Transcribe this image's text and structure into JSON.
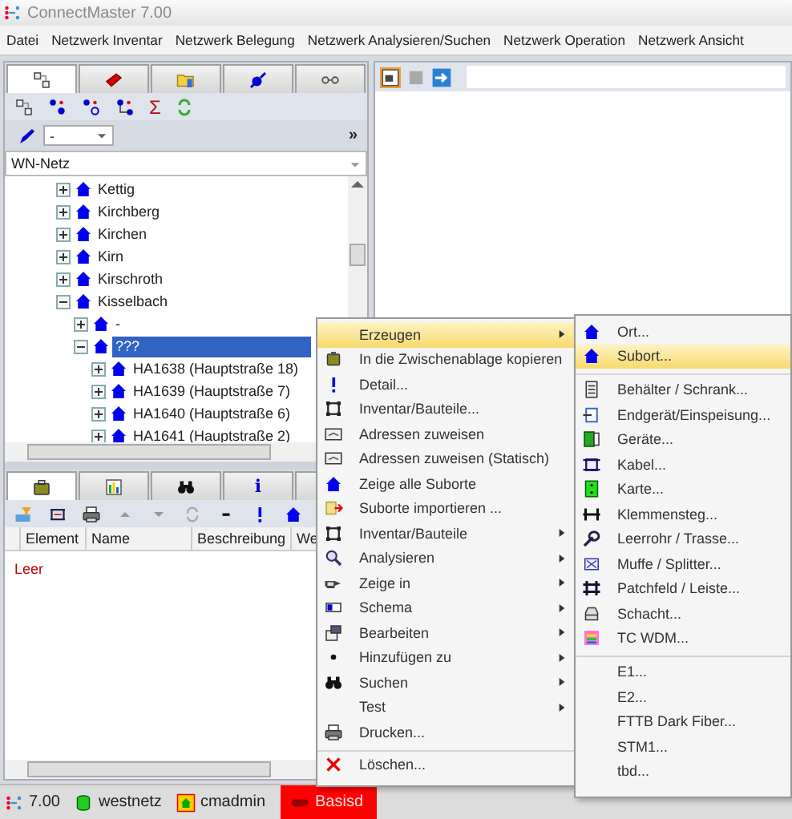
{
  "window": {
    "title": "ConnectMaster 7.00"
  },
  "menu_bar": [
    "Datei",
    "Netzwerk Inventar",
    "Netzwerk Belegung",
    "Netzwerk Analysieren/Suchen",
    "Netzwerk Operation",
    "Netzwerk Ansicht"
  ],
  "left_panel": {
    "tabs": [
      {
        "selected": true
      },
      {
        "selected": false
      },
      {
        "selected": false
      },
      {
        "selected": false
      },
      {
        "selected": false
      }
    ],
    "sigma": "Σ",
    "filter_value": "-",
    "more": "»",
    "network": "WN-Netz",
    "tree": [
      {
        "label": "Kettig",
        "expanded": false,
        "selected": false
      },
      {
        "label": "Kirchberg",
        "expanded": false,
        "selected": false
      },
      {
        "label": "Kirchen",
        "expanded": false,
        "selected": false
      },
      {
        "label": "Kirn",
        "expanded": false,
        "selected": false
      },
      {
        "label": "Kirschroth",
        "expanded": false,
        "selected": false
      },
      {
        "label": "Kisselbach",
        "expanded": true,
        "selected": false,
        "children": [
          {
            "label": "-",
            "expanded": false,
            "selected": false
          },
          {
            "label": "???",
            "expanded": true,
            "selected": true,
            "children": [
              {
                "label": "HA1638 (Hauptstraße 18)",
                "expanded": false,
                "selected": false
              },
              {
                "label": "HA1639 (Hauptstraße 7)",
                "expanded": false,
                "selected": false
              },
              {
                "label": "HA1640 (Hauptstraße 6)",
                "expanded": false,
                "selected": false
              },
              {
                "label": "HA1641 (Hauptstraße 2)",
                "expanded": false,
                "selected": false
              }
            ]
          }
        ]
      }
    ]
  },
  "bottom_panel": {
    "tabs": [
      {
        "selected": true
      },
      {
        "selected": false
      },
      {
        "selected": false
      },
      {
        "selected": false,
        "label": "i"
      },
      {
        "selected": false
      }
    ],
    "columns": [
      "Element",
      "Name",
      "Beschreibung",
      "We"
    ],
    "empty_text": "Leer"
  },
  "status_bar": {
    "version": "7.00",
    "database": "westnetz",
    "user": "cmadmin",
    "mode": "Basisd"
  },
  "context_menu": [
    {
      "label": "Erzeugen",
      "submenu": true,
      "selected": true,
      "divider_before": false
    },
    {
      "label": "In die Zwischenablage kopieren",
      "submenu": false,
      "selected": false,
      "divider_before": false
    },
    {
      "label": "Detail...",
      "submenu": false,
      "selected": false,
      "divider_before": false
    },
    {
      "label": "Inventar/Bauteile...",
      "submenu": false,
      "selected": false,
      "divider_before": false
    },
    {
      "label": "Adressen zuweisen",
      "submenu": false,
      "selected": false,
      "divider_before": false
    },
    {
      "label": "Adressen zuweisen (Statisch)",
      "submenu": false,
      "selected": false,
      "divider_before": false
    },
    {
      "label": "Zeige alle Suborte",
      "submenu": false,
      "selected": false,
      "divider_before": false
    },
    {
      "label": "Suborte importieren ...",
      "submenu": false,
      "selected": false,
      "divider_before": false
    },
    {
      "label": "Inventar/Bauteile",
      "submenu": true,
      "selected": false,
      "divider_before": false
    },
    {
      "label": "Analysieren",
      "submenu": true,
      "selected": false,
      "divider_before": false
    },
    {
      "label": "Zeige in",
      "submenu": true,
      "selected": false,
      "divider_before": false
    },
    {
      "label": "Schema",
      "submenu": true,
      "selected": false,
      "divider_before": false
    },
    {
      "label": "Bearbeiten",
      "submenu": true,
      "selected": false,
      "divider_before": false
    },
    {
      "label": "Hinzufügen zu",
      "submenu": true,
      "selected": false,
      "divider_before": false
    },
    {
      "label": "Suchen",
      "submenu": true,
      "selected": false,
      "divider_before": false
    },
    {
      "label": "Test",
      "submenu": true,
      "selected": false,
      "divider_before": false
    },
    {
      "label": "Drucken...",
      "submenu": false,
      "selected": false,
      "divider_before": false
    },
    {
      "label": "Löschen...",
      "submenu": false,
      "selected": false,
      "divider_before": true
    }
  ],
  "submenu": [
    {
      "label": "Ort...",
      "selected": false,
      "divider_before": false
    },
    {
      "label": "Subort...",
      "selected": true,
      "divider_before": false
    },
    {
      "label": "Behälter / Schrank...",
      "selected": false,
      "divider_before": true
    },
    {
      "label": "Endgerät/Einspeisung...",
      "selected": false,
      "divider_before": false
    },
    {
      "label": "Geräte...",
      "selected": false,
      "divider_before": false
    },
    {
      "label": "Kabel...",
      "selected": false,
      "divider_before": false
    },
    {
      "label": "Karte...",
      "selected": false,
      "divider_before": false
    },
    {
      "label": "Klemmensteg...",
      "selected": false,
      "divider_before": false
    },
    {
      "label": "Leerrohr / Trasse...",
      "selected": false,
      "divider_before": false
    },
    {
      "label": "Muffe / Splitter...",
      "selected": false,
      "divider_before": false
    },
    {
      "label": "Patchfeld / Leiste...",
      "selected": false,
      "divider_before": false
    },
    {
      "label": "Schacht...",
      "selected": false,
      "divider_before": false
    },
    {
      "label": "TC WDM...",
      "selected": false,
      "divider_before": false
    },
    {
      "label": "E1...",
      "selected": false,
      "divider_before": true
    },
    {
      "label": "E2...",
      "selected": false,
      "divider_before": false
    },
    {
      "label": "FTTB Dark Fiber...",
      "selected": false,
      "divider_before": false
    },
    {
      "label": "STM1...",
      "selected": false,
      "divider_before": false
    },
    {
      "label": "tbd...",
      "selected": false,
      "divider_before": false
    }
  ]
}
